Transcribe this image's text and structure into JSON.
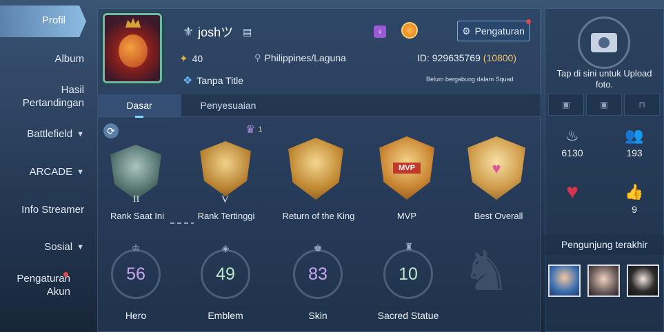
{
  "nav": {
    "active": "Profil",
    "items": [
      {
        "label": "Album",
        "chevron": false
      },
      {
        "label": "Hasil\nPertandingan",
        "line1": "Hasil",
        "line2": "Pertandingan",
        "chevron": false
      },
      {
        "label": "Battlefield",
        "chevron": true
      },
      {
        "label": "ARCADE",
        "chevron": true
      },
      {
        "label": "Info Streamer",
        "chevron": false
      },
      {
        "label": "Sosial",
        "chevron": true
      },
      {
        "label": "Pengaturan Akun",
        "line1": "Pengaturan",
        "line2": "Akun",
        "chevron": false,
        "notify": true
      }
    ]
  },
  "profile": {
    "username": "joshツ",
    "level": "40",
    "location": "Philippines/Laguna",
    "id_label": "ID: 929635769",
    "server": "(10800)",
    "title": "Tanpa Title",
    "squad": "Belum bergabung dalam Squad",
    "gender_icon": "female-icon",
    "settings_label": "Pengaturan"
  },
  "tabs": [
    "Dasar",
    "Penyesuaian"
  ],
  "top_badge_count": "1",
  "ranks": [
    {
      "label": "Rank Saat Ini",
      "tier": "II",
      "color": "#6f8a86"
    },
    {
      "label": "Rank Tertinggi",
      "tier": "V",
      "color": "#c89a4a"
    },
    {
      "label": "Return of the King",
      "color": "#d8a447"
    },
    {
      "label": "MVP",
      "color": "#d89a3c"
    },
    {
      "label": "Best Overall",
      "color": "#e1b05a"
    }
  ],
  "stats": [
    {
      "label": "Hero",
      "value": "56",
      "color": "#c9a6f2",
      "icon": "hero-icon"
    },
    {
      "label": "Emblem",
      "value": "49",
      "color": "#b8e6c8",
      "icon": "emblem-icon"
    },
    {
      "label": "Skin",
      "value": "83",
      "color": "#c9a6f2",
      "icon": "skin-icon"
    },
    {
      "label": "Sacred Statue",
      "value": "10",
      "color": "#b8e6c8",
      "icon": "statue-icon"
    }
  ],
  "right": {
    "upload_text_1": "Tap di sini untuk Upload",
    "upload_text_2": "foto.",
    "popularity": "6130",
    "friends": "193",
    "likes": "9",
    "visitors_heading": "Pengunjung terakhir"
  }
}
